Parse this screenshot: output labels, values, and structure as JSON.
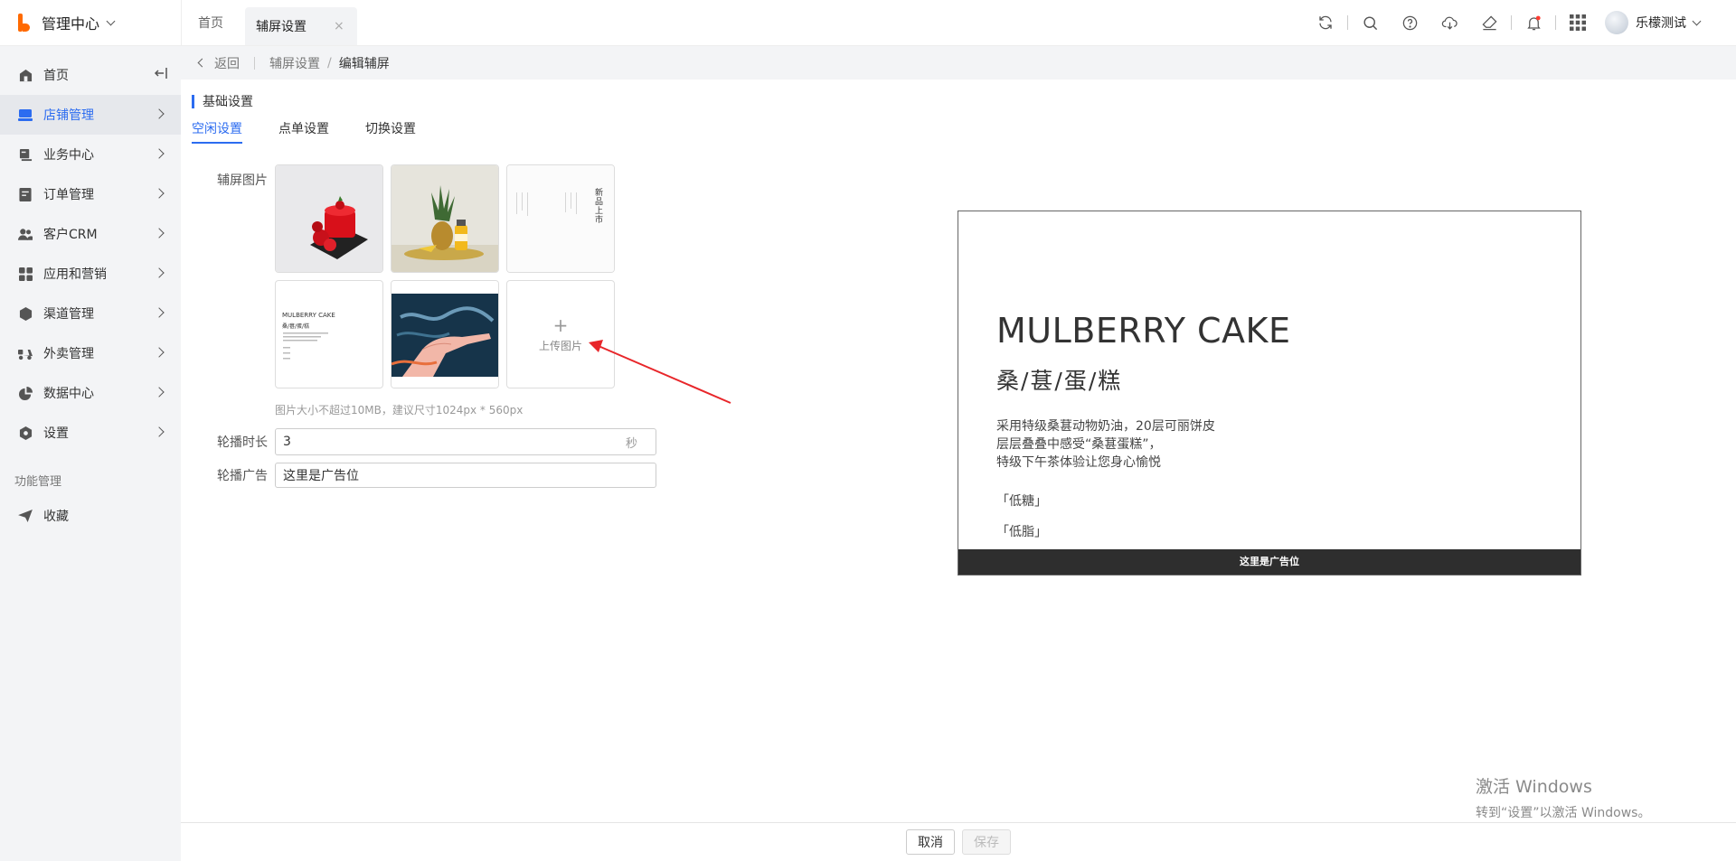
{
  "header": {
    "brand_title": "管理中心",
    "tabs": [
      {
        "label": "首页",
        "active": false
      },
      {
        "label": "辅屏设置",
        "active": true
      }
    ],
    "tab_close_symbol": "×",
    "user_name": "乐檬测试",
    "icons": [
      "refresh-icon",
      "search-icon",
      "help-icon",
      "cloud-download-icon",
      "eraser-icon",
      "bell-icon",
      "apps-grid-icon"
    ],
    "notification_color": "#ff3b30"
  },
  "sidebar": {
    "items": [
      {
        "label": "首页",
        "icon": "home-icon",
        "active": false
      },
      {
        "label": "店铺管理",
        "icon": "store-icon",
        "active": true
      },
      {
        "label": "业务中心",
        "icon": "business-icon",
        "active": false
      },
      {
        "label": "订单管理",
        "icon": "order-icon",
        "active": false
      },
      {
        "label": "客户CRM",
        "icon": "customers-icon",
        "active": false
      },
      {
        "label": "应用和营销",
        "icon": "apps-icon",
        "active": false
      },
      {
        "label": "渠道管理",
        "icon": "channel-icon",
        "active": false
      },
      {
        "label": "外卖管理",
        "icon": "delivery-icon",
        "active": false
      },
      {
        "label": "数据中心",
        "icon": "pie-chart-icon",
        "active": false
      },
      {
        "label": "设置",
        "icon": "settings-icon",
        "active": false
      }
    ],
    "section_label": "功能管理",
    "favorites_label": "收藏"
  },
  "breadcrumb": {
    "back_label": "返回",
    "parent": "辅屏设置",
    "separator": "/",
    "current": "编辑辅屏"
  },
  "form": {
    "section_title": "基础设置",
    "sub_tabs": [
      {
        "label": "空闲设置",
        "active": true
      },
      {
        "label": "点单设置",
        "active": false
      },
      {
        "label": "切换设置",
        "active": false
      }
    ],
    "images_label": "辅屏图片",
    "upload_label": "上传图片",
    "upload_plus": "+",
    "hint": "图片大小不超过10MB，建议尺寸1024px * 560px",
    "duration_label": "轮播时长",
    "duration_value": "3",
    "duration_unit": "秒",
    "ad_label": "轮播广告",
    "ad_value": "这里是广告位",
    "thumb3_text": "新品上市",
    "thumb4_title": "MULBERRY CAKE",
    "thumb4_subtitle": "桑/葚/蛋/糕"
  },
  "preview": {
    "title": "MULBERRY CAKE",
    "subtitle": "桑/葚/蛋/糕",
    "desc_lines": [
      "采用特级桑葚动物奶油，20层可丽饼皮",
      "层层叠叠中感受“桑葚蛋糕”，",
      "特级下午茶体验让您身心愉悦"
    ],
    "tags": [
      "「低糖」",
      "「低脂」"
    ],
    "ad_text": "这里是广告位"
  },
  "footer": {
    "cancel_label": "取消",
    "save_label": "保存"
  },
  "windows_activation": {
    "line1": "激活 Windows",
    "line2": "转到“设置”以激活 Windows。"
  },
  "colors": {
    "accent": "#2c6cf0",
    "brand": "#ff6a00",
    "annotation_arrow": "#e8262a"
  }
}
